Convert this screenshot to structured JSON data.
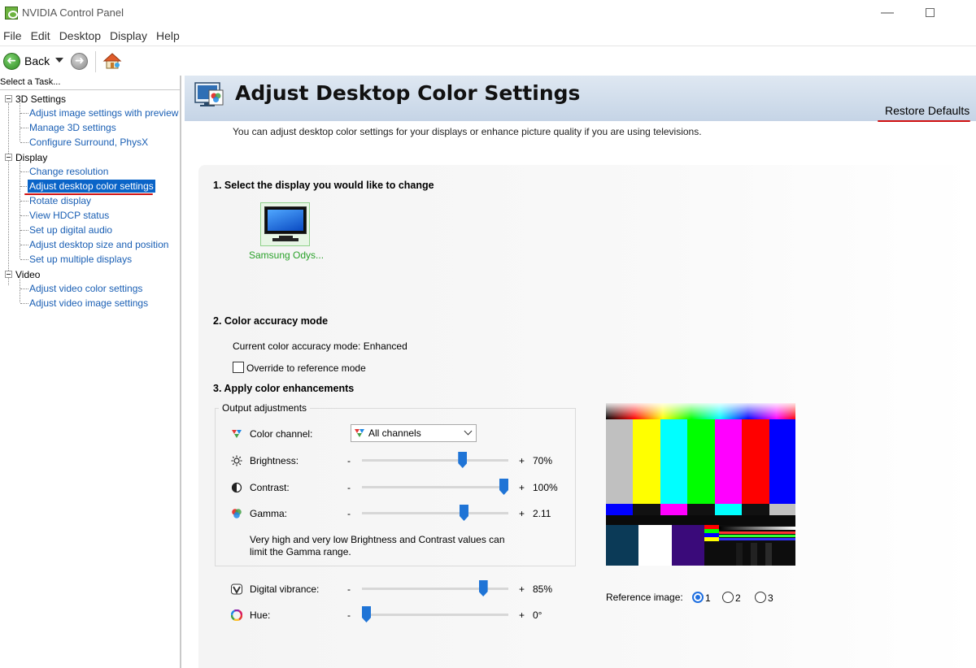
{
  "window": {
    "title": "NVIDIA Control Panel",
    "minimize_glyph": "—",
    "brand_color": "#76b900"
  },
  "menu": [
    "File",
    "Edit",
    "Desktop",
    "Display",
    "Help"
  ],
  "toolbar": {
    "back_label": "Back",
    "back_icon": "back-arrow-icon",
    "forward_icon": "forward-arrow-icon",
    "home_icon": "home-icon"
  },
  "sidebar": {
    "header": "Select a Task...",
    "categories": [
      {
        "label": "3D Settings",
        "items": [
          "Adjust image settings with preview",
          "Manage 3D settings",
          "Configure Surround, PhysX"
        ]
      },
      {
        "label": "Display",
        "items": [
          "Change resolution",
          "Adjust desktop color settings",
          "Rotate display",
          "View HDCP status",
          "Set up digital audio",
          "Adjust desktop size and position",
          "Set up multiple displays"
        ]
      },
      {
        "label": "Video",
        "items": [
          "Adjust video color settings",
          "Adjust video image settings"
        ]
      }
    ],
    "selected": "Adjust desktop color settings",
    "selection_color": "#0a64c8",
    "link_color": "#1a5fb4"
  },
  "page": {
    "title": "Adjust Desktop Color Settings",
    "restore_defaults": "Restore Defaults",
    "description": "You can adjust desktop color settings for your displays or enhance picture quality if you are using televisions."
  },
  "section1": {
    "title": "1. Select the display you would like to change",
    "display_name": "Samsung Odys..."
  },
  "section2": {
    "title": "2. Color accuracy mode",
    "current_mode": "Current color accuracy mode: Enhanced",
    "override_label": "Override to reference mode",
    "override_checked": false
  },
  "section3": {
    "title": "3. Apply color enhancements",
    "output_group": "Output adjustments",
    "color_channel_label": "Color channel:",
    "color_channel_value": "All channels",
    "sliders": {
      "brightness": {
        "label": "Brightness:",
        "value": "70%",
        "level": 0.7,
        "minus": "-",
        "plus": "+"
      },
      "contrast": {
        "label": "Contrast:",
        "value": "100%",
        "level": 1.0,
        "minus": "-",
        "plus": "+"
      },
      "gamma": {
        "label": "Gamma:",
        "value": "2.11",
        "level": 0.71,
        "minus": "-",
        "plus": "+"
      },
      "vibrance": {
        "label": "Digital vibrance:",
        "value": "85%",
        "level": 0.85,
        "minus": "-",
        "plus": "+"
      },
      "hue": {
        "label": "Hue:",
        "value": "0°",
        "level": 0.0,
        "minus": "-",
        "plus": "+"
      }
    },
    "gamma_note": "Very high and very low Brightness and Contrast values can limit the Gamma range.",
    "reference_label": "Reference image:",
    "reference_options": [
      "1",
      "2",
      "3"
    ],
    "reference_selected": "1",
    "accent_color": "#1f74d6"
  }
}
